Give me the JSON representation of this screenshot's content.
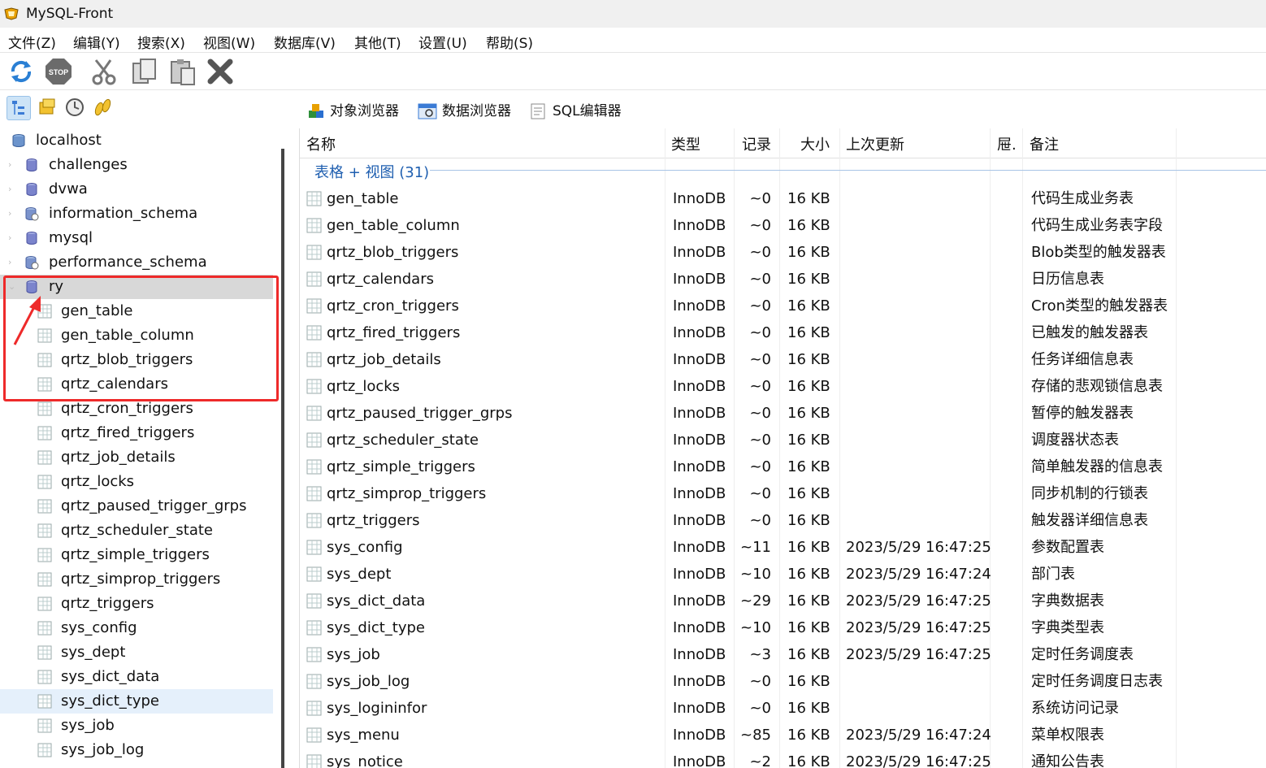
{
  "app": {
    "title": "MySQL-Front"
  },
  "menu": [
    "文件(Z)",
    "编辑(Y)",
    "搜索(X)",
    "视图(W)",
    "数据库(V)",
    "其他(T)",
    "设置(U)",
    "帮助(S)"
  ],
  "toolbar": [
    "refresh-icon",
    "stop-icon",
    "cut-icon",
    "copy-icon",
    "paste-icon",
    "delete-icon"
  ],
  "view_buttons": [
    "tree-view-icon",
    "favorites-icon",
    "history-icon",
    "jobs-icon"
  ],
  "tabs": [
    "对象浏览器",
    "数据浏览器",
    "SQL编辑器"
  ],
  "tree": {
    "root": "localhost",
    "databases": [
      "challenges",
      "dvwa",
      "information_schema",
      "mysql",
      "performance_schema",
      "ry"
    ],
    "ry_tables": [
      "gen_table",
      "gen_table_column",
      "qrtz_blob_triggers",
      "qrtz_calendars",
      "qrtz_cron_triggers",
      "qrtz_fired_triggers",
      "qrtz_job_details",
      "qrtz_locks",
      "qrtz_paused_trigger_grps",
      "qrtz_scheduler_state",
      "qrtz_simple_triggers",
      "qrtz_simprop_triggers",
      "qrtz_triggers",
      "sys_config",
      "sys_dept",
      "sys_dict_data",
      "sys_dict_type",
      "sys_job",
      "sys_job_log"
    ],
    "selected": "ry",
    "hovered": "sys_dict_type"
  },
  "grid": {
    "columns": [
      "名称",
      "类型",
      "记录",
      "大小",
      "上次更新",
      "屉.",
      "备注"
    ],
    "group_label": "表格 + 视图 (31)",
    "rows": [
      [
        "gen_table",
        "InnoDB",
        "~0",
        "16 KB",
        "",
        "代码生成业务表"
      ],
      [
        "gen_table_column",
        "InnoDB",
        "~0",
        "16 KB",
        "",
        "代码生成业务表字段"
      ],
      [
        "qrtz_blob_triggers",
        "InnoDB",
        "~0",
        "16 KB",
        "",
        "Blob类型的触发器表"
      ],
      [
        "qrtz_calendars",
        "InnoDB",
        "~0",
        "16 KB",
        "",
        "日历信息表"
      ],
      [
        "qrtz_cron_triggers",
        "InnoDB",
        "~0",
        "16 KB",
        "",
        "Cron类型的触发器表"
      ],
      [
        "qrtz_fired_triggers",
        "InnoDB",
        "~0",
        "16 KB",
        "",
        "已触发的触发器表"
      ],
      [
        "qrtz_job_details",
        "InnoDB",
        "~0",
        "16 KB",
        "",
        "任务详细信息表"
      ],
      [
        "qrtz_locks",
        "InnoDB",
        "~0",
        "16 KB",
        "",
        "存储的悲观锁信息表"
      ],
      [
        "qrtz_paused_trigger_grps",
        "InnoDB",
        "~0",
        "16 KB",
        "",
        "暂停的触发器表"
      ],
      [
        "qrtz_scheduler_state",
        "InnoDB",
        "~0",
        "16 KB",
        "",
        "调度器状态表"
      ],
      [
        "qrtz_simple_triggers",
        "InnoDB",
        "~0",
        "16 KB",
        "",
        "简单触发器的信息表"
      ],
      [
        "qrtz_simprop_triggers",
        "InnoDB",
        "~0",
        "16 KB",
        "",
        "同步机制的行锁表"
      ],
      [
        "qrtz_triggers",
        "InnoDB",
        "~0",
        "16 KB",
        "",
        "触发器详细信息表"
      ],
      [
        "sys_config",
        "InnoDB",
        "~11",
        "16 KB",
        "2023/5/29 16:47:25",
        "参数配置表"
      ],
      [
        "sys_dept",
        "InnoDB",
        "~10",
        "16 KB",
        "2023/5/29 16:47:24",
        "部门表"
      ],
      [
        "sys_dict_data",
        "InnoDB",
        "~29",
        "16 KB",
        "2023/5/29 16:47:25",
        "字典数据表"
      ],
      [
        "sys_dict_type",
        "InnoDB",
        "~10",
        "16 KB",
        "2023/5/29 16:47:25",
        "字典类型表"
      ],
      [
        "sys_job",
        "InnoDB",
        "~3",
        "16 KB",
        "2023/5/29 16:47:25",
        "定时任务调度表"
      ],
      [
        "sys_job_log",
        "InnoDB",
        "~0",
        "16 KB",
        "",
        "定时任务调度日志表"
      ],
      [
        "sys_logininfor",
        "InnoDB",
        "~0",
        "16 KB",
        "",
        "系统访问记录"
      ],
      [
        "sys_menu",
        "InnoDB",
        "~85",
        "16 KB",
        "2023/5/29 16:47:24",
        "菜单权限表"
      ],
      [
        "sys_notice",
        "InnoDB",
        "~2",
        "16 KB",
        "2023/5/29 16:47:25",
        "通知公告表"
      ]
    ]
  },
  "colors": {
    "highlight_box": "#ee2a2a",
    "group_text": "#1f5fb0",
    "selected_row": "#d8d8d8"
  }
}
